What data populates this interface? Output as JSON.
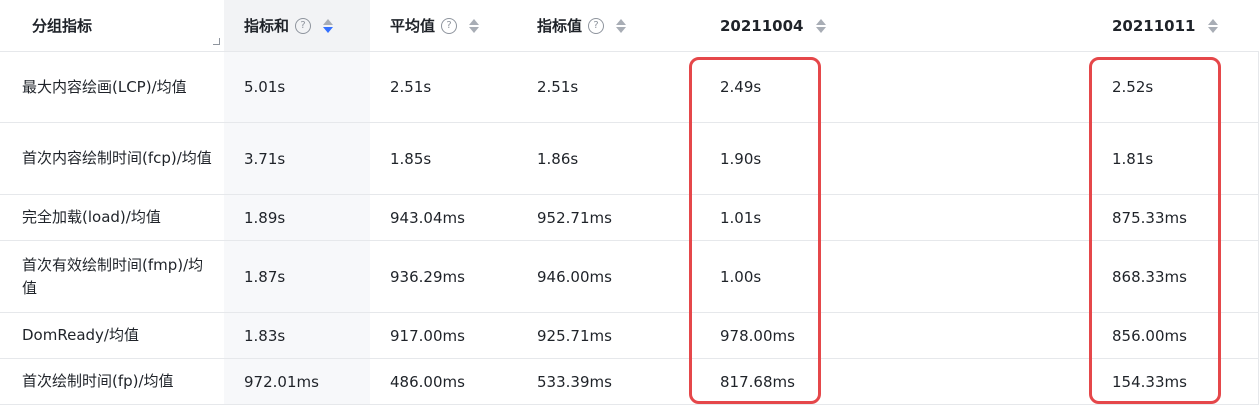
{
  "columns": {
    "group": "分组指标",
    "sum": "指标和",
    "avg": "平均值",
    "metric": "指标值",
    "date1": "20211004",
    "date2": "20211011"
  },
  "help_glyph": "?",
  "icons": {
    "help": "question-circle-icon",
    "sort": "sort-caret-icon"
  },
  "sort_state": {
    "sum": "descending"
  },
  "colors": {
    "highlight": "#e5474a",
    "sort_active": "#3370ff",
    "sum_column_bg": "#f7f8fa"
  },
  "rows": [
    {
      "label": "最大内容绘画(LCP)/均值",
      "sum": "5.01s",
      "avg": "2.51s",
      "metric": "2.51s",
      "date1": "2.49s",
      "date2": "2.52s"
    },
    {
      "label": "首次内容绘制时间(fcp)/均值",
      "sum": "3.71s",
      "avg": "1.85s",
      "metric": "1.86s",
      "date1": "1.90s",
      "date2": "1.81s"
    },
    {
      "label": "完全加载(load)/均值",
      "sum": "1.89s",
      "avg": "943.04ms",
      "metric": "952.71ms",
      "date1": "1.01s",
      "date2": "875.33ms"
    },
    {
      "label": "首次有效绘制时间(fmp)/均值",
      "sum": "1.87s",
      "avg": "936.29ms",
      "metric": "946.00ms",
      "date1": "1.00s",
      "date2": "868.33ms"
    },
    {
      "label": "DomReady/均值",
      "sum": "1.83s",
      "avg": "917.00ms",
      "metric": "925.71ms",
      "date1": "978.00ms",
      "date2": "856.00ms"
    },
    {
      "label": "首次绘制时间(fp)/均值",
      "sum": "972.01ms",
      "avg": "486.00ms",
      "metric": "533.39ms",
      "date1": "817.68ms",
      "date2": "154.33ms"
    }
  ]
}
